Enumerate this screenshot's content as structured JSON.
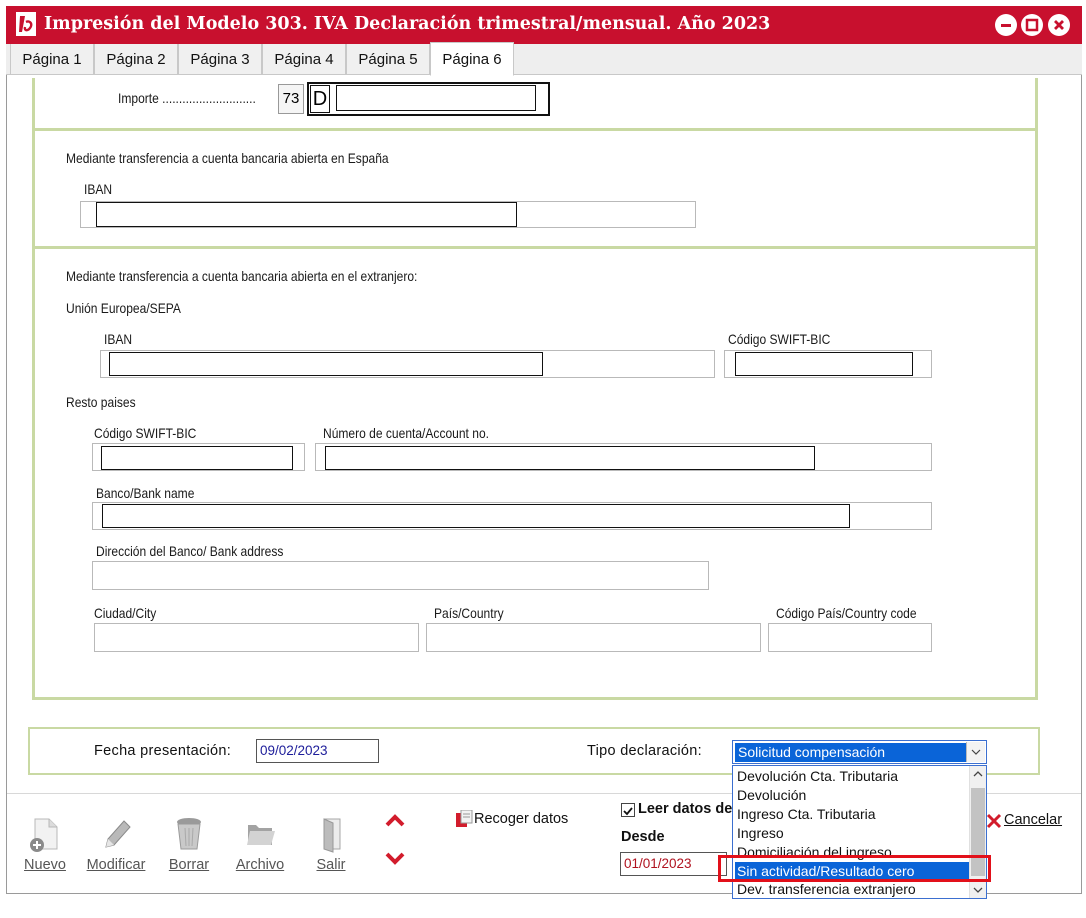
{
  "window": {
    "title": "Impresión del Modelo 303. IVA Declaración trimestral/mensual. Año 2023",
    "title_bar_color": "#c8102e"
  },
  "tabs": [
    {
      "label": "Página 1"
    },
    {
      "label": "Página 2"
    },
    {
      "label": "Página 3"
    },
    {
      "label": "Página 4"
    },
    {
      "label": "Página 5"
    },
    {
      "label": "Página 6",
      "active": true
    }
  ],
  "form": {
    "importe": {
      "label": "Importe",
      "box": "73",
      "letter": "D",
      "value": ""
    },
    "espana": {
      "heading": "Mediante transferencia a cuenta bancaria abierta en España",
      "iban_label": "IBAN",
      "iban_value": ""
    },
    "extranjero": {
      "heading": "Mediante transferencia a cuenta bancaria abierta en el extranjero:",
      "ue_heading": "Unión Europea/SEPA",
      "iban_label": "IBAN",
      "swift_label": "Código SWIFT-BIC",
      "resto_heading": "Resto paises",
      "resto_swift_label": "Código SWIFT-BIC",
      "account_label": "Número de cuenta/Account no.",
      "bank_name_label": "Banco/Bank name",
      "bank_address_label": "Dirección del Banco/ Bank address",
      "city_label": "Ciudad/City",
      "country_label": "País/Country",
      "country_code_label": "Código País/Country code"
    }
  },
  "bottom": {
    "fecha_label": "Fecha presentación:",
    "fecha_value": "09/02/2023",
    "tipo_label": "Tipo declaración:",
    "tipo_value": "Solicitud compensación",
    "tipo_options": [
      "Devolución Cta. Tributaria",
      "Devolución",
      "Ingreso Cta. Tributaria",
      "Ingreso",
      "Domiciliación del ingreso",
      "Sin actividad/Resultado cero",
      "Dev. transferencia extranjero"
    ],
    "highlighted_option": "Sin actividad/Resultado cero"
  },
  "toolbar": {
    "nuevo": "Nuevo",
    "modificar": "Modificar",
    "borrar": "Borrar",
    "archivo": "Archivo",
    "salir": "Salir",
    "recoger": "Recoger datos",
    "leer_label": "Leer datos de",
    "leer_checked": true,
    "desde_label": "Desde",
    "desde_value": "01/01/2023",
    "cancelar": "Cancelar"
  }
}
